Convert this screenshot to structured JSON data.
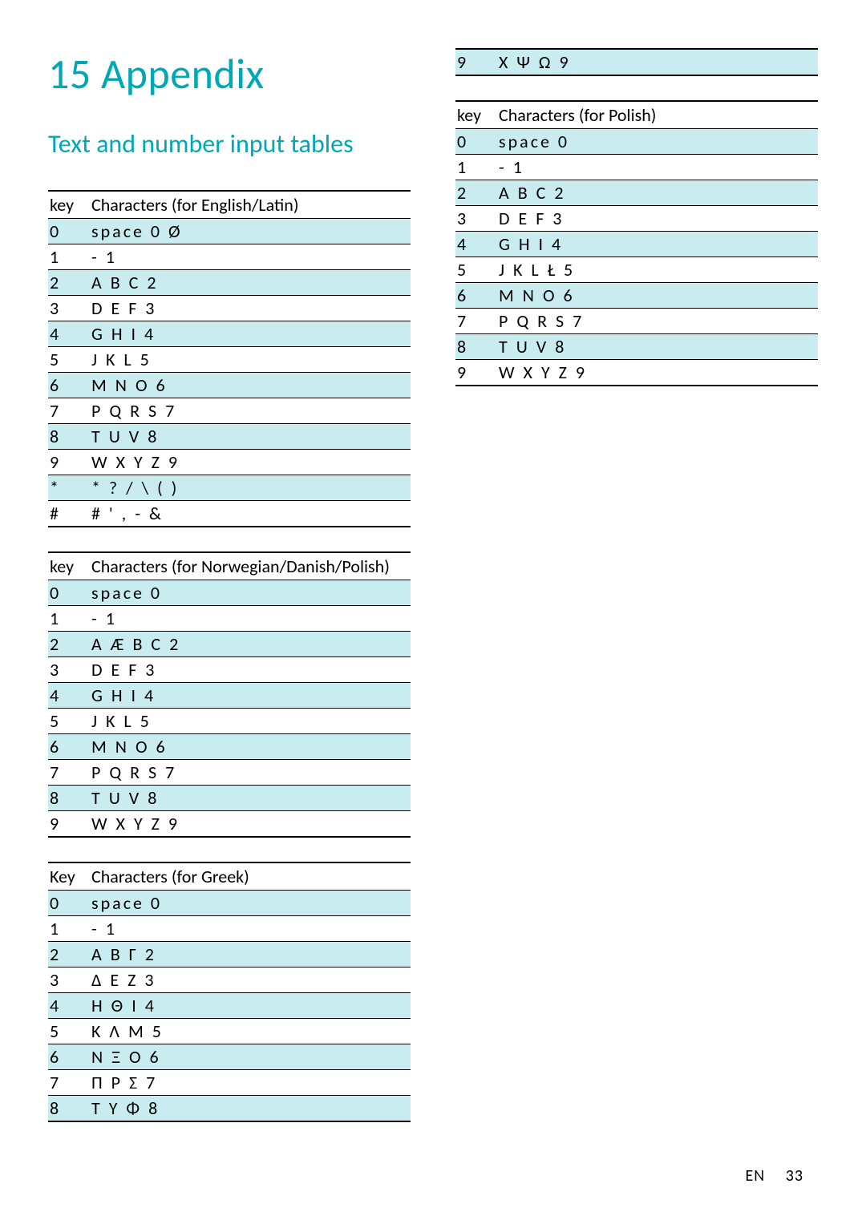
{
  "chapter_number": "15",
  "chapter_title": "Appendix",
  "section_title": "Text and number input tables",
  "tables": [
    {
      "key_header": "key",
      "chars_header": "Characters (for English/Latin)",
      "rows": [
        {
          "k": "0",
          "v": "space 0 Ø"
        },
        {
          "k": "1",
          "v": "- 1"
        },
        {
          "k": "2",
          "v": "A B C 2"
        },
        {
          "k": "3",
          "v": "D E F 3"
        },
        {
          "k": "4",
          "v": "G H I 4"
        },
        {
          "k": "5",
          "v": "J K L 5"
        },
        {
          "k": "6",
          "v": "M N O 6"
        },
        {
          "k": "7",
          "v": "P Q R S 7"
        },
        {
          "k": "8",
          "v": "T U V 8"
        },
        {
          "k": "9",
          "v": "W X Y Z 9"
        },
        {
          "k": "*",
          "v": "* ? / \\ ( )"
        },
        {
          "k": "#",
          "v": "# ' , - &"
        }
      ]
    },
    {
      "key_header": "key",
      "chars_header": "Characters (for Norwegian/Danish/Polish)",
      "rows": [
        {
          "k": "0",
          "v": "space 0"
        },
        {
          "k": "1",
          "v": "- 1"
        },
        {
          "k": "2",
          "v": "A Æ B C 2"
        },
        {
          "k": "3",
          "v": "D E F 3"
        },
        {
          "k": "4",
          "v": "G H I 4"
        },
        {
          "k": "5",
          "v": "J K L 5"
        },
        {
          "k": "6",
          "v": "M N O 6"
        },
        {
          "k": "7",
          "v": "P Q R S 7"
        },
        {
          "k": "8",
          "v": "T U V 8"
        },
        {
          "k": "9",
          "v": "W X Y Z 9"
        }
      ]
    },
    {
      "key_header": "Key",
      "chars_header": "Characters (for Greek)",
      "rows": [
        {
          "k": "0",
          "v": "space 0"
        },
        {
          "k": "1",
          "v": "- 1"
        },
        {
          "k": "2",
          "v": "Α Β Γ 2"
        },
        {
          "k": "3",
          "v": "Δ Ε Ζ 3"
        },
        {
          "k": "4",
          "v": "Η Θ Ι 4"
        },
        {
          "k": "5",
          "v": "Κ Λ Μ 5"
        },
        {
          "k": "6",
          "v": "Ν Ξ Ο 6"
        },
        {
          "k": "7",
          "v": "Π Ρ Σ 7"
        },
        {
          "k": "8",
          "v": "Τ Υ Φ 8"
        }
      ]
    }
  ],
  "tables_right": [
    {
      "continuation": true,
      "rows": [
        {
          "k": "9",
          "v": "Χ Ψ Ω 9"
        }
      ]
    },
    {
      "key_header": "key",
      "chars_header": "Characters (for Polish)",
      "rows": [
        {
          "k": "0",
          "v": "space 0"
        },
        {
          "k": "1",
          "v": "- 1"
        },
        {
          "k": "2",
          "v": "A B C 2"
        },
        {
          "k": "3",
          "v": "D E F 3"
        },
        {
          "k": "4",
          "v": "G H I 4"
        },
        {
          "k": "5",
          "v": "J K L Ł 5"
        },
        {
          "k": "6",
          "v": "M N O 6"
        },
        {
          "k": "7",
          "v": "P Q R S 7"
        },
        {
          "k": "8",
          "v": "T U V 8"
        },
        {
          "k": "9",
          "v": "W X Y Z 9"
        }
      ]
    }
  ],
  "footer": {
    "lang": "EN",
    "page": "33"
  }
}
